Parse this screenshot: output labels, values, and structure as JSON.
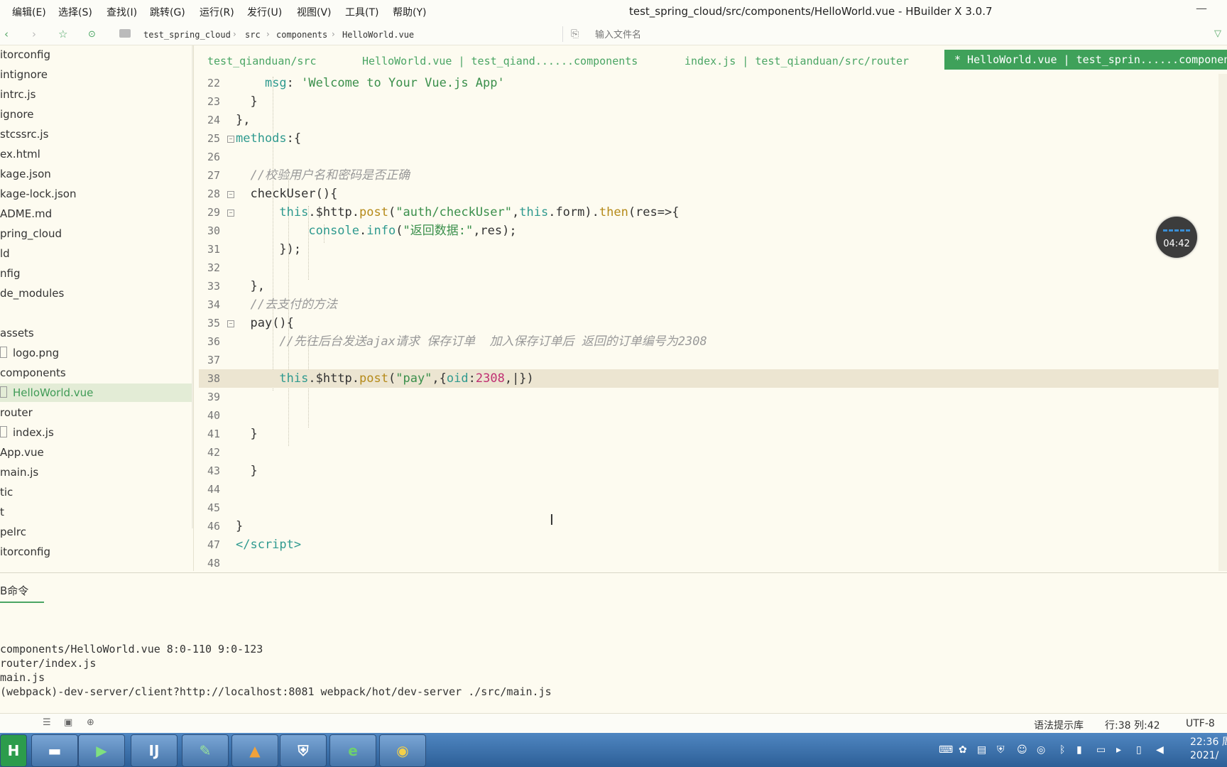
{
  "menubar": {
    "items": [
      "编辑(E)",
      "选择(S)",
      "查找(I)",
      "跳转(G)",
      "运行(R)",
      "发行(U)",
      "视图(V)",
      "工具(T)",
      "帮助(Y)"
    ],
    "window_title": "test_spring_cloud/src/components/HelloWorld.vue - HBuilder X 3.0.7"
  },
  "toolbar": {
    "breadcrumb": [
      "test_spring_cloud",
      "src",
      "components",
      "HelloWorld.vue"
    ],
    "file_search_placeholder": "输入文件名"
  },
  "sidebar": {
    "items": [
      {
        "label": "itorconfig"
      },
      {
        "label": "intignore"
      },
      {
        "label": "intrc.js"
      },
      {
        "label": "ignore"
      },
      {
        "label": "stcssrc.js"
      },
      {
        "label": "ex.html"
      },
      {
        "label": "kage.json"
      },
      {
        "label": "kage-lock.json"
      },
      {
        "label": "ADME.md"
      },
      {
        "label": "pring_cloud"
      },
      {
        "label": "ld"
      },
      {
        "label": "nfig"
      },
      {
        "label": "de_modules"
      },
      {
        "label": ""
      },
      {
        "label": "assets"
      },
      {
        "label": "logo.png",
        "file": true
      },
      {
        "label": "components"
      },
      {
        "label": "HelloWorld.vue",
        "file": true,
        "selected": true
      },
      {
        "label": "router"
      },
      {
        "label": "index.js",
        "file": true
      },
      {
        "label": "App.vue"
      },
      {
        "label": "main.js"
      },
      {
        "label": "tic"
      },
      {
        "label": "t"
      },
      {
        "label": "pelrc"
      },
      {
        "label": "itorconfig"
      }
    ]
  },
  "tabs": [
    {
      "label": "test_qianduan/src"
    },
    {
      "label": "HelloWorld.vue | test_qiand......components"
    },
    {
      "label": "index.js | test_qianduan/src/router"
    },
    {
      "label": "* HelloWorld.vue | test_sprin......components",
      "active": true
    }
  ],
  "editor": {
    "lines": [
      {
        "n": "22",
        "html": "    <span class='k'>msg</span><span class='p'>: </span><span class='s'>'Welcome to Your Vue.js App'</span>"
      },
      {
        "n": "23",
        "html": "  <span class='p'>}</span>"
      },
      {
        "n": "24",
        "html": "<span class='p'>},</span>"
      },
      {
        "n": "25",
        "fold": true,
        "html": "<span class='k'>methods</span><span class='p'>:{</span>"
      },
      {
        "n": "26",
        "html": ""
      },
      {
        "n": "27",
        "html": "  <span class='c'>//校验用户名和密码是否正确</span>"
      },
      {
        "n": "28",
        "fold": true,
        "html": "  <span class='d'>checkUser(){</span>"
      },
      {
        "n": "29",
        "fold": true,
        "html": "      <span class='k'>this</span><span class='p'>.$http.</span><span class='f'>post</span><span class='p'>(</span><span class='s'>\"auth/checkUser\"</span><span class='p'>,</span><span class='k'>this</span><span class='p'>.form).</span><span class='f'>then</span><span class='p'>(res=>{</span>"
      },
      {
        "n": "30",
        "html": "          <span class='k'>console</span><span class='p'>.</span><span class='k'>info</span><span class='p'>(</span><span class='s'>\"返回数据:\"</span><span class='p'>,res);</span>"
      },
      {
        "n": "31",
        "html": "      <span class='p'>});</span>"
      },
      {
        "n": "32",
        "html": ""
      },
      {
        "n": "33",
        "html": "  <span class='p'>},</span>"
      },
      {
        "n": "34",
        "html": "  <span class='c'>//去支付的方法</span>"
      },
      {
        "n": "35",
        "fold": true,
        "html": "  <span class='d'>pay(){</span>"
      },
      {
        "n": "36",
        "html": "      <span class='c'>//先往后台发送ajax请求 保存订单  加入保存订单后 返回的订单编号为2308</span>"
      },
      {
        "n": "37",
        "html": ""
      },
      {
        "n": "38",
        "current": true,
        "html": "      <span class='k'>this</span><span class='p'>.$http.</span><span class='f'>post</span><span class='p'>(</span><span class='s'>\"pay\"</span><span class='p'>,{</span><span class='k'>oid</span><span class='p'>:</span><span class='n'>2308</span><span class='p'>,|})</span>"
      },
      {
        "n": "39",
        "html": ""
      },
      {
        "n": "40",
        "html": ""
      },
      {
        "n": "41",
        "html": "  <span class='p'>}</span>"
      },
      {
        "n": "42",
        "html": ""
      },
      {
        "n": "43",
        "html": "  <span class='p'>}</span>"
      },
      {
        "n": "44",
        "html": ""
      },
      {
        "n": "45",
        "html": ""
      },
      {
        "n": "46",
        "html": "<span class='p'>}</span>"
      },
      {
        "n": "47",
        "html": "<span class='k'>&lt;/script&gt;</span>"
      },
      {
        "n": "48",
        "html": ""
      }
    ]
  },
  "timer": {
    "value": "04:42"
  },
  "console": {
    "tab_label": "B命令",
    "lines": [
      "components/HelloWorld.vue 8:0-110 9:0-123",
      "router/index.js",
      "main.js",
      "(webpack)-dev-server/client?http://localhost:8081 webpack/hot/dev-server ./src/main.js"
    ]
  },
  "statusbar": {
    "syntax_lib": "语法提示库",
    "position": "行:38  列:42",
    "encoding": "UTF-8"
  },
  "taskbar": {
    "time": "22:36 周",
    "date": "2021/"
  }
}
